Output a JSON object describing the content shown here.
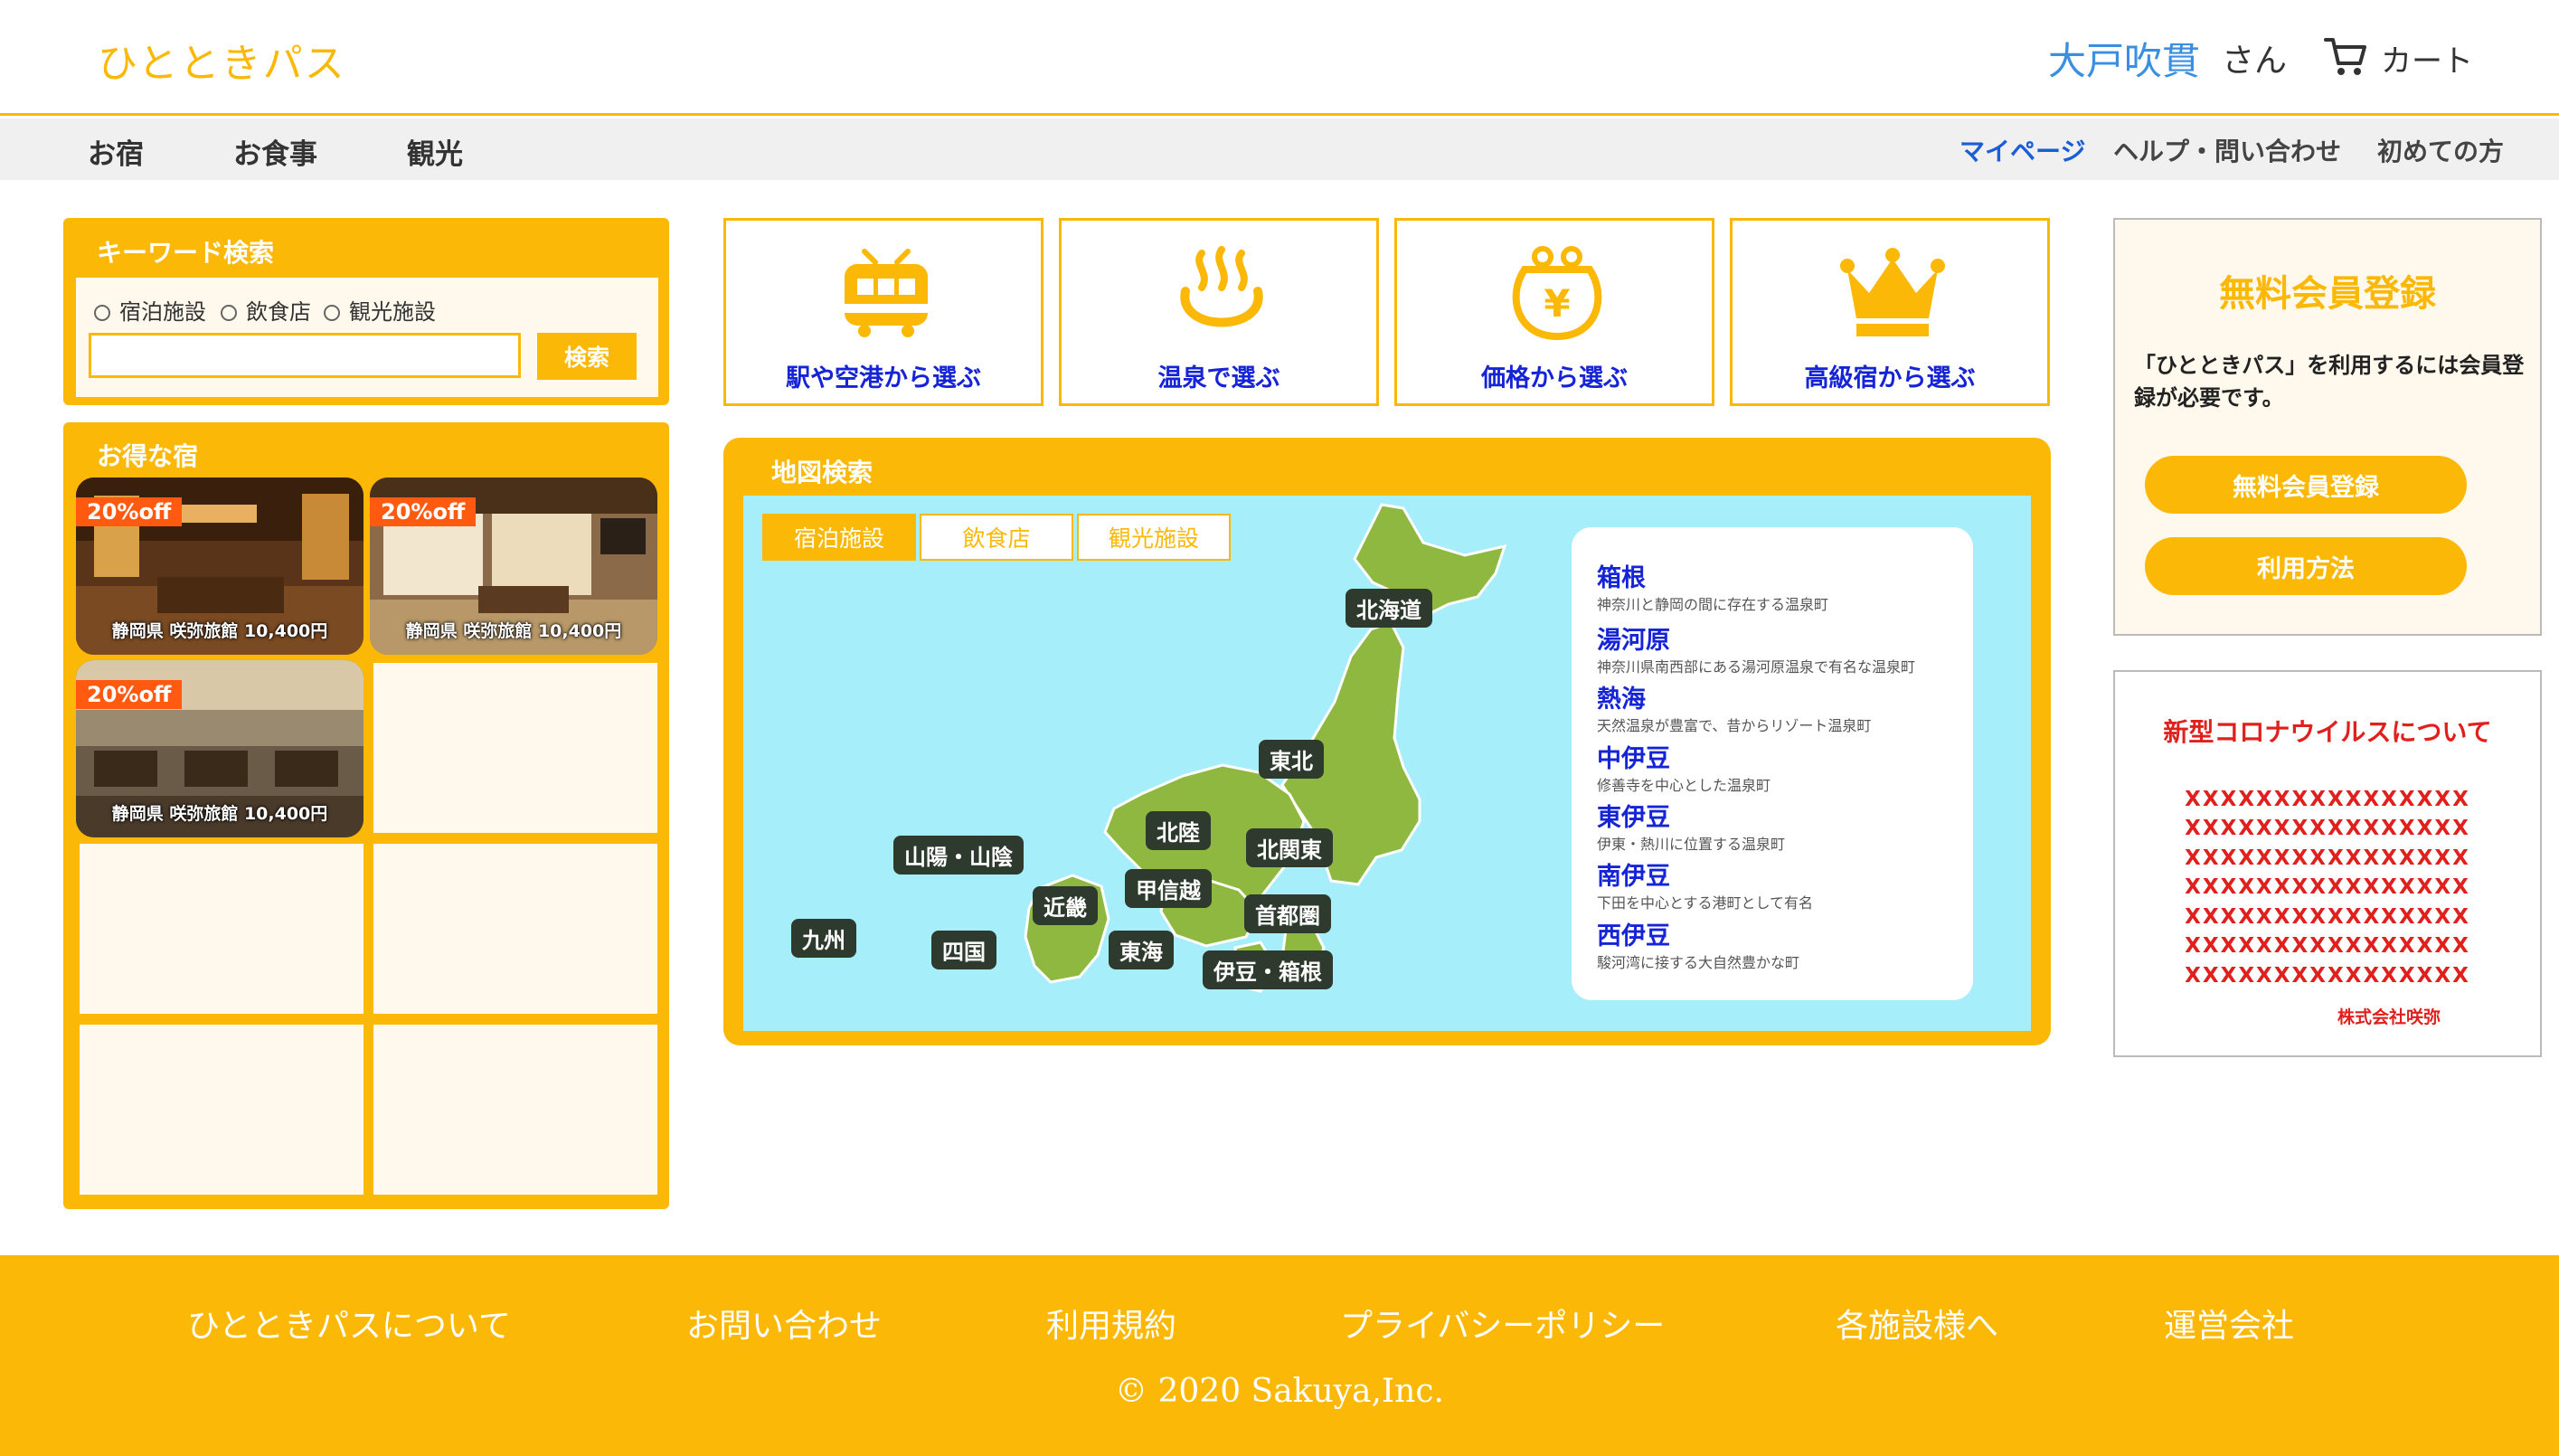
{
  "header": {
    "logo": "ひとときパス",
    "user_name": "大戸吹貫",
    "user_suffix": "さん",
    "cart_label": "カート"
  },
  "nav": {
    "left": [
      "お宿",
      "お食事",
      "観光"
    ],
    "right": [
      "マイページ",
      "ヘルプ・問い合わせ",
      "初めての方"
    ]
  },
  "keyword_search": {
    "title": "キーワード検索",
    "options": [
      "宿泊施設",
      "飲食店",
      "観光施設"
    ],
    "input_value": "",
    "button": "検索"
  },
  "deals": {
    "title": "お得な宿",
    "cards": [
      {
        "discount": "20%off",
        "caption": "静岡県 咲弥旅館 10,400円"
      },
      {
        "discount": "20%off",
        "caption": "静岡県 咲弥旅館 10,400円"
      },
      {
        "discount": "20%off",
        "caption": "静岡県 咲弥旅館 10,400円"
      }
    ]
  },
  "categories": [
    {
      "label": "駅や空港から選ぶ",
      "icon": "train-icon"
    },
    {
      "label": "温泉で選ぶ",
      "icon": "hot-spring-icon"
    },
    {
      "label": "価格から選ぶ",
      "icon": "yen-purse-icon"
    },
    {
      "label": "高級宿から選ぶ",
      "icon": "crown-icon"
    }
  ],
  "map_search": {
    "title": "地図検索",
    "tabs": [
      "宿泊施設",
      "飲食店",
      "観光施設"
    ],
    "active_tab": "宿泊施設",
    "regions": [
      "北海道",
      "東北",
      "北陸",
      "北関東",
      "山陽・山陰",
      "甲信越",
      "近畿",
      "首都圏",
      "九州",
      "四国",
      "東海",
      "伊豆・箱根"
    ],
    "onsen": [
      {
        "name": "箱根",
        "desc": "神奈川と静岡の間に存在する温泉町"
      },
      {
        "name": "湯河原",
        "desc": "神奈川県南西部にある湯河原温泉で有名な温泉町"
      },
      {
        "name": "熱海",
        "desc": "天然温泉が豊富で、昔からリゾート温泉町"
      },
      {
        "name": "中伊豆",
        "desc": "修善寺を中心とした温泉町"
      },
      {
        "name": "東伊豆",
        "desc": "伊東・熱川に位置する温泉町"
      },
      {
        "name": "南伊豆",
        "desc": "下田を中心とする港町として有名"
      },
      {
        "name": "西伊豆",
        "desc": "駿河湾に接する大自然豊かな町"
      }
    ]
  },
  "registration": {
    "title": "無料会員登録",
    "text": "「ひとときパス」を利用するには会員登録が必要です。",
    "register_button": "無料会員登録",
    "howto_button": "利用方法"
  },
  "notice": {
    "title": "新型コロナウイルスについて",
    "lines": [
      "XXXXXXXXXXXXXXXX",
      "XXXXXXXXXXXXXXXX",
      "XXXXXXXXXXXXXXXX",
      "XXXXXXXXXXXXXXXX",
      "XXXXXXXXXXXXXXXX",
      "XXXXXXXXXXXXXXXX",
      "XXXXXXXXXXXXXXXX"
    ],
    "company": "株式会社咲弥"
  },
  "footer": {
    "links": [
      "ひとときパスについて",
      "お問い合わせ",
      "利用規約",
      "プライバシーポリシー",
      "各施設様へ",
      "運営会社"
    ],
    "copyright": "© 2020 Sakuya,Inc."
  },
  "colors": {
    "accent": "#fbb806",
    "link_blue": "#1424d6",
    "discount": "#ff5a10",
    "notice_red": "#e0201c",
    "sea": "#a6eefa",
    "land": "#8fb840"
  }
}
